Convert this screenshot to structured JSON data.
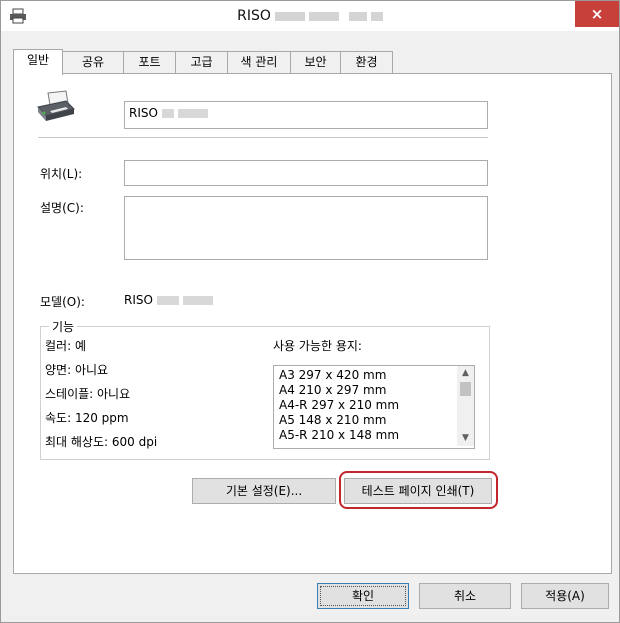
{
  "window": {
    "title": "RISO",
    "close_label": "×"
  },
  "tabs": [
    {
      "label": "일반"
    },
    {
      "label": "공유"
    },
    {
      "label": "포트"
    },
    {
      "label": "고급"
    },
    {
      "label": "색 관리"
    },
    {
      "label": "보안"
    },
    {
      "label": "환경"
    }
  ],
  "general": {
    "printer_name": "RISO",
    "location_label": "위치(L):",
    "location_value": "",
    "comment_label": "설명(C):",
    "comment_value": "",
    "model_label": "모델(O):",
    "model_value": "RISO"
  },
  "features": {
    "title": "기능",
    "color": "컬러: 예",
    "duplex": "양면: 아니요",
    "staple": "스테이플: 아니요",
    "speed": "속도: 120 ppm",
    "max_resolution": "최대 해상도: 600 dpi",
    "paper_label": "사용 가능한 용지:",
    "paper_sizes": [
      "A3 297 x 420 mm",
      "A4 210 x 297 mm",
      "A4-R 297 x 210 mm",
      "A5 148 x 210 mm",
      "A5-R 210 x 148 mm"
    ]
  },
  "buttons": {
    "preferences": "기본 설정(E)...",
    "print_test_page": "테스트 페이지 인쇄(T)",
    "ok": "확인",
    "cancel": "취소",
    "apply": "적용(A)"
  },
  "icons": {
    "title_icon": "printer-icon",
    "printer_image": "printer-icon",
    "scroll_up": "chevron-up-icon",
    "scroll_down": "chevron-down-icon"
  },
  "colors": {
    "close_button": "#c7403a",
    "highlight": "#c1272d"
  }
}
